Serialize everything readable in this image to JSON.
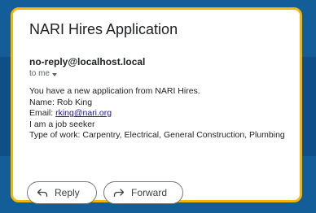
{
  "email": {
    "subject": "NARI Hires Application",
    "sender": "no-reply@localhost.local",
    "recipient_label": "to me",
    "body": {
      "intro": "You have a new application from NARI Hires.",
      "name_line": "Name: Rob King",
      "email_label": "Email: ",
      "email_link": "rking@nari.org",
      "seeker_line": "I am a job seeker",
      "work_type_line": "Type of work: Carpentry, Electrical, General Construction, Plumbing"
    }
  },
  "actions": {
    "reply_label": "Reply",
    "forward_label": "Forward"
  },
  "colors": {
    "background": "#0d4f86",
    "card_border": "#f7b500",
    "link": "#1a0dab"
  }
}
